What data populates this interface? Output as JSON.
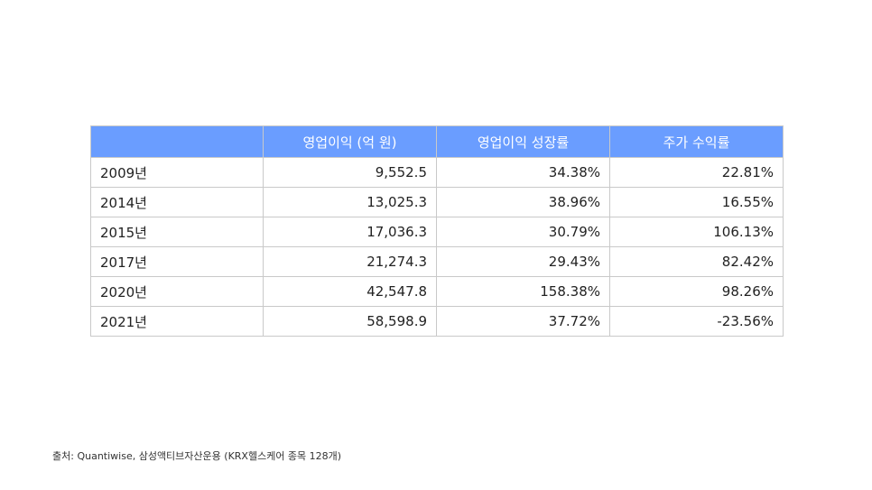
{
  "table": {
    "headers": [
      "",
      "영업이익 (억 원)",
      "영업이익 성장률",
      "주가 수익률"
    ],
    "rows": [
      [
        "2009년",
        "9,552.5",
        "34.38%",
        "22.81%"
      ],
      [
        "2014년",
        "13,025.3",
        "38.96%",
        "16.55%"
      ],
      [
        "2015년",
        "17,036.3",
        "30.79%",
        "106.13%"
      ],
      [
        "2017년",
        "21,274.3",
        "29.43%",
        "82.42%"
      ],
      [
        "2020년",
        "42,547.8",
        "158.38%",
        "98.26%"
      ],
      [
        "2021년",
        "58,598.9",
        "37.72%",
        "-23.56%"
      ]
    ]
  },
  "source": "출처: Quantiwise, 삼성액티브자산운용 (KRX헬스케어 종목 128개)",
  "colors": {
    "header_bg": "#6a9dff",
    "header_text": "#ffffff",
    "border": "#c9c9c9"
  }
}
